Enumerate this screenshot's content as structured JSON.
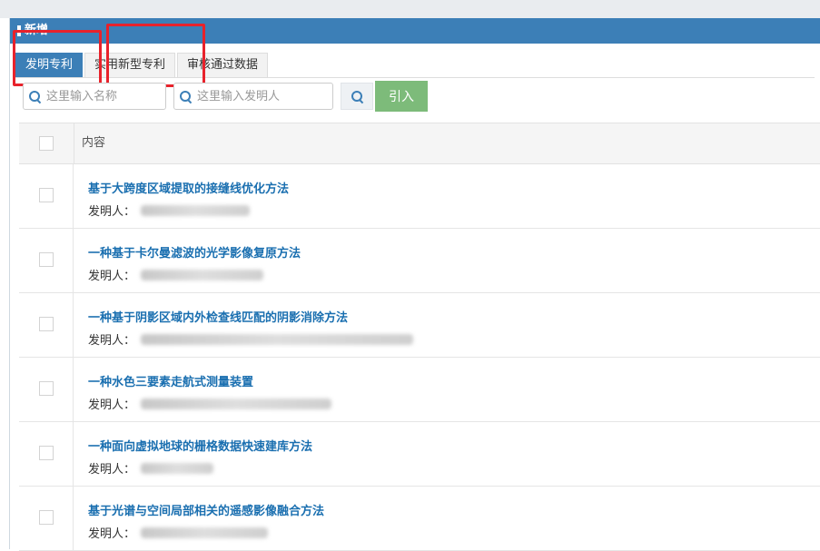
{
  "background_strip": {
    "text": ""
  },
  "dialog": {
    "title": "新增"
  },
  "tabs": [
    {
      "label": "发明专利",
      "active": true
    },
    {
      "label": "实用新型专利",
      "active": false
    },
    {
      "label": "审核通过数据",
      "active": false
    }
  ],
  "search": {
    "name_placeholder": "这里输入名称",
    "inventor_placeholder": "这里输入发明人",
    "import_label": "引入"
  },
  "table": {
    "header": "内容",
    "inventor_prefix": "发明人：",
    "rows": [
      {
        "title": "基于大跨度区域提取的接缝线优化方法"
      },
      {
        "title": "一种基于卡尔曼滤波的光学影像复原方法"
      },
      {
        "title": "一种基于阴影区域内外检查线匹配的阴影消除方法"
      },
      {
        "title": "一种水色三要素走航式测量装置"
      },
      {
        "title": "一种面向虚拟地球的栅格数据快速建库方法"
      },
      {
        "title": "基于光谱与空间局部相关的遥感影像融合方法"
      }
    ]
  },
  "colors": {
    "header_blue": "#3c7fb7",
    "link_blue": "#1a6fb0",
    "import_green": "#7dbb7a",
    "highlight_red": "#e8222b"
  }
}
